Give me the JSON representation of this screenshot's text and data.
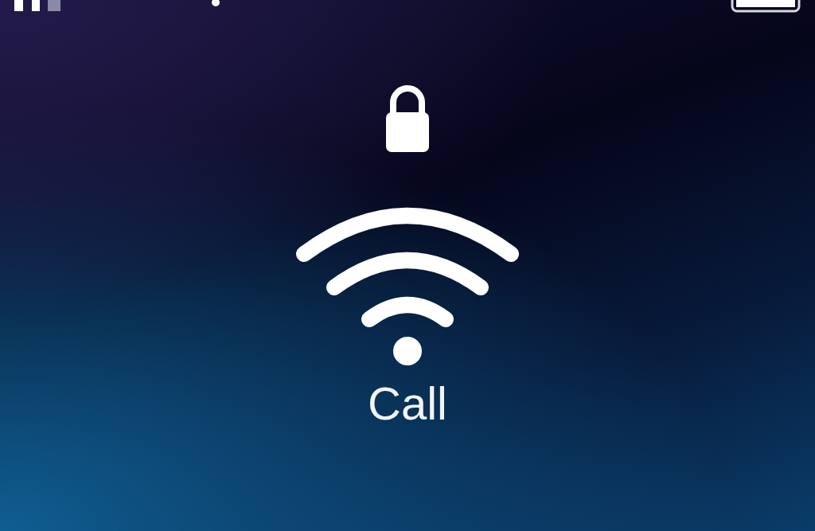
{
  "call": {
    "label": "Call"
  }
}
